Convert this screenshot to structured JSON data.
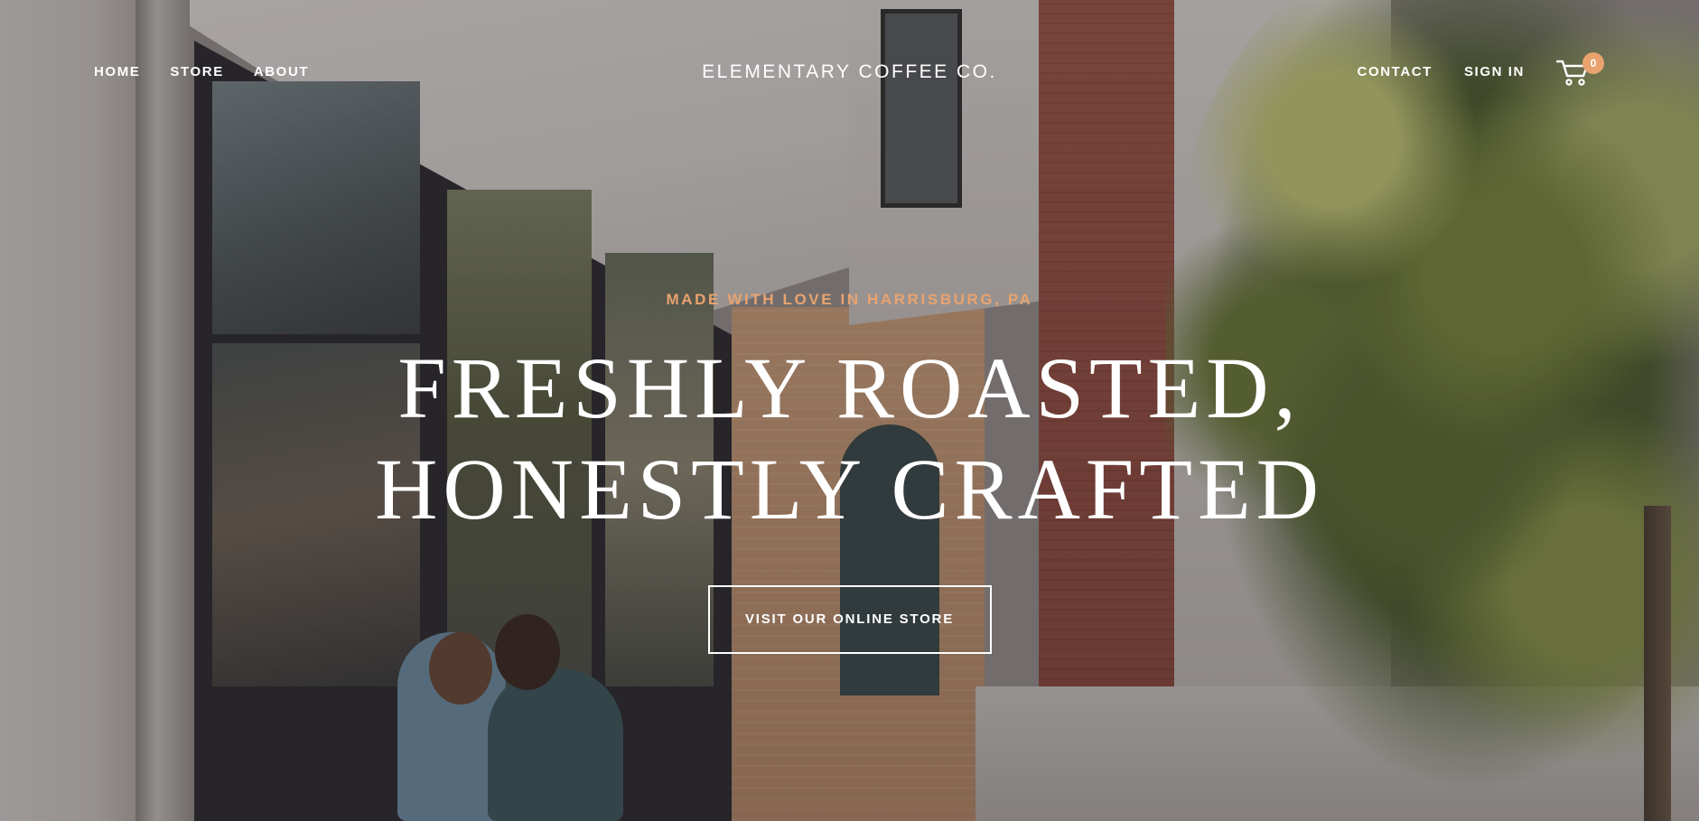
{
  "header": {
    "site_title": "ELEMENTARY COFFEE CO.",
    "nav_left": [
      {
        "label": "HOME"
      },
      {
        "label": "STORE"
      },
      {
        "label": "ABOUT"
      }
    ],
    "nav_right": [
      {
        "label": "CONTACT"
      },
      {
        "label": "SIGN IN"
      }
    ],
    "cart": {
      "icon": "cart-icon",
      "count": "0",
      "badge_color": "#e8a36f"
    }
  },
  "hero": {
    "kicker": "MADE WITH LOVE IN HARRISBURG, PA",
    "kicker_color": "#e8a36f",
    "headline_line1": "FRESHLY ROASTED,",
    "headline_line2": "HONESTLY CRAFTED",
    "cta_label": "VISIT OUR ONLINE STORE"
  },
  "colors": {
    "accent": "#e8a36f",
    "text": "#ffffff"
  }
}
